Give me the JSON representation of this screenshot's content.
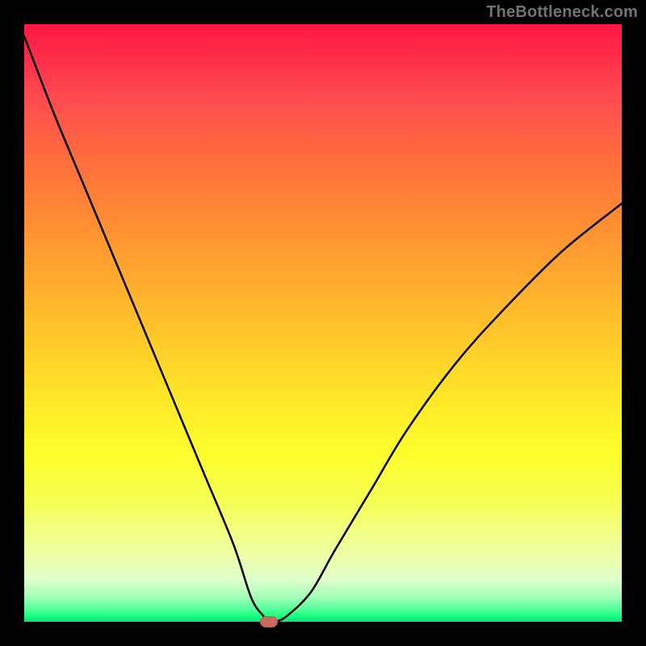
{
  "watermark": "TheBottleneck.com",
  "chart_data": {
    "type": "line",
    "title": "",
    "xlabel": "",
    "ylabel": "",
    "xlim": [
      0,
      100
    ],
    "ylim": [
      0,
      100
    ],
    "background_gradient": {
      "top": "#ff1744",
      "mid": "#ffd728",
      "bottom": "#00e676"
    },
    "series": [
      {
        "name": "bottleneck-curve",
        "x": [
          0,
          5,
          10,
          15,
          20,
          25,
          30,
          35,
          38,
          40,
          41,
          42,
          44,
          48,
          52,
          58,
          64,
          72,
          80,
          90,
          100
        ],
        "y": [
          98,
          85,
          73,
          61,
          49,
          37,
          25,
          13,
          4,
          1,
          0,
          0,
          1,
          5,
          12,
          22,
          32,
          43,
          52,
          62,
          70
        ]
      }
    ],
    "marker": {
      "name": "selected-point",
      "x": 41,
      "y": 0,
      "color": "#c96a5f"
    },
    "grid": false,
    "legend": false
  }
}
